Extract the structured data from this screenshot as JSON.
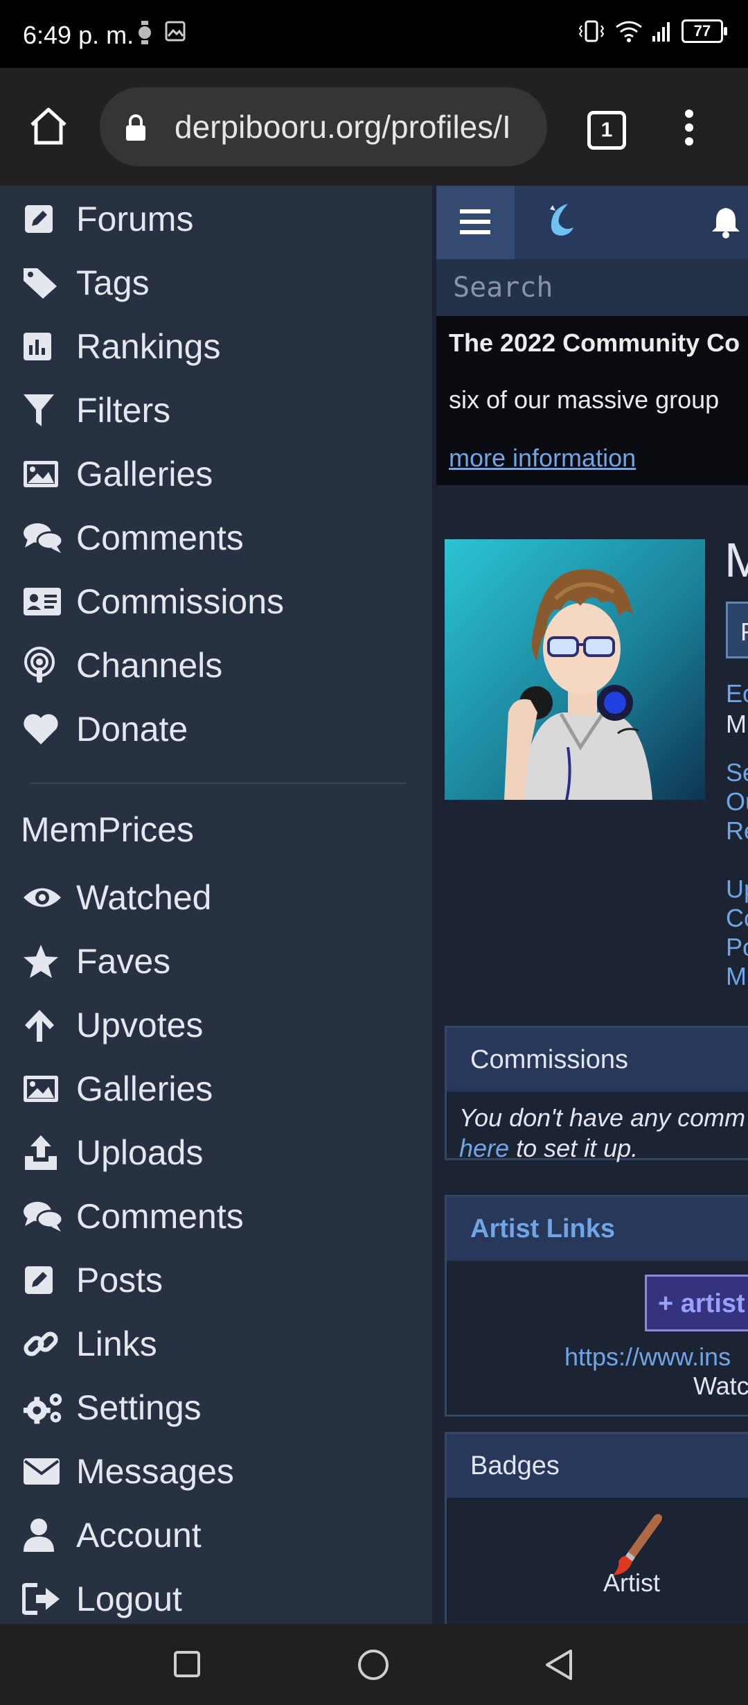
{
  "status_bar": {
    "time": "6:49 p. m.",
    "battery": "77"
  },
  "browser": {
    "url": "derpibooru.org/profiles/I",
    "tab_count": "1"
  },
  "sidebar": {
    "site_items": [
      {
        "label": "Forums",
        "icon": "edit-icon"
      },
      {
        "label": "Tags",
        "icon": "tag-icon"
      },
      {
        "label": "Rankings",
        "icon": "chart-icon"
      },
      {
        "label": "Filters",
        "icon": "filter-icon"
      },
      {
        "label": "Galleries",
        "icon": "image-icon"
      },
      {
        "label": "Comments",
        "icon": "comments-icon"
      },
      {
        "label": "Commissions",
        "icon": "id-card-icon"
      },
      {
        "label": "Channels",
        "icon": "podcast-icon"
      },
      {
        "label": "Donate",
        "icon": "heart-icon"
      }
    ],
    "user_header": "MemPrices",
    "user_items": [
      {
        "label": "Watched",
        "icon": "eye-icon"
      },
      {
        "label": "Faves",
        "icon": "star-icon"
      },
      {
        "label": "Upvotes",
        "icon": "arrow-up-icon"
      },
      {
        "label": "Galleries",
        "icon": "image-icon"
      },
      {
        "label": "Uploads",
        "icon": "upload-icon"
      },
      {
        "label": "Comments",
        "icon": "comments-icon"
      },
      {
        "label": "Posts",
        "icon": "edit-icon"
      },
      {
        "label": "Links",
        "icon": "link-icon"
      },
      {
        "label": "Settings",
        "icon": "cogs-icon"
      },
      {
        "label": "Messages",
        "icon": "envelope-icon"
      },
      {
        "label": "Account",
        "icon": "user-icon"
      },
      {
        "label": "Logout",
        "icon": "sign-out-icon"
      }
    ]
  },
  "content": {
    "search_placeholder": "Search",
    "notice": {
      "title": "The 2022 Community Co",
      "body": "six of our massive group",
      "link": "more information"
    },
    "profile": {
      "name_fragment": "M",
      "button_fragment": "F",
      "links_a": [
        "Ec",
        "M"
      ],
      "links_b": [
        "Se",
        "Ou",
        "Re"
      ],
      "links_c": [
        "Up",
        "Cc",
        "Po",
        "M"
      ]
    },
    "commissions": {
      "title": "Commissions",
      "text_1": "You don't have any comm",
      "link": "here",
      "text_2": " to set it up."
    },
    "artist_links": {
      "title": "Artist Links",
      "button": "+ artist",
      "url": "https://www.ins",
      "watch": "Watc"
    },
    "badges": {
      "title": "Badges",
      "label": "Artist"
    }
  },
  "colors": {
    "sidebar_bg": "#283142",
    "content_bg": "#1c2333",
    "link": "#6fa6e8",
    "header_bg": "#27385a"
  }
}
